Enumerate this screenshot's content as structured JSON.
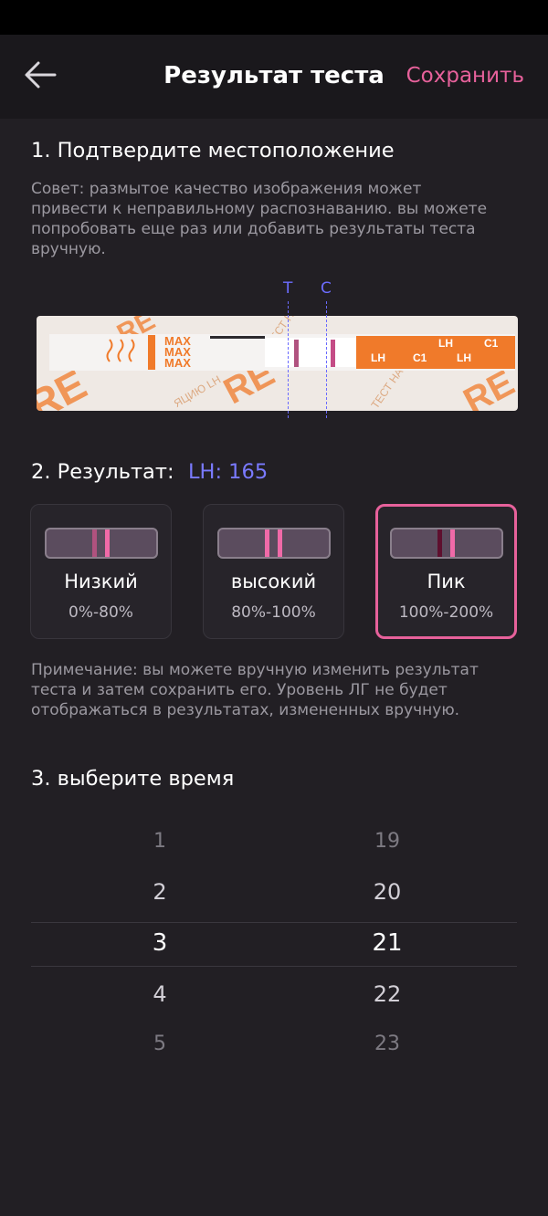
{
  "header": {
    "title": "Результат теста",
    "save_label": "Сохранить"
  },
  "step1": {
    "title": "1. Подтвердите местоположение",
    "hint_lines": [
      "Совет: размытое качество изображения может",
      "привести к неправильному распознаванию. вы можете",
      "попробовать еще раз или добавить результаты теста",
      "вручную."
    ],
    "marker_t": "T",
    "marker_c": "C",
    "strip_text": {
      "max": "MAX",
      "lh": "LH",
      "c1": "C1",
      "brand": "RE",
      "test_ha": "ТЕСТ НА",
      "ovulation": "ЯЦИЮ LH"
    }
  },
  "step2": {
    "title": "2. Результат:",
    "value": "LH: 165",
    "options": [
      {
        "name": "Низкий",
        "range": "0%-80%"
      },
      {
        "name": "высокий",
        "range": "80%-100%"
      },
      {
        "name": "Пик",
        "range": "100%-200%"
      }
    ],
    "selected_option": "Пик",
    "note_lines": [
      "Примечание: вы можете вручную изменить результат",
      "теста и затем сохранить его. Уровень ЛГ не будет",
      "отображаться в результатах, измененных вручную."
    ]
  },
  "step3": {
    "title": "3. выберите время",
    "hours": [
      "1",
      "2",
      "3",
      "4",
      "5"
    ],
    "minutes": [
      "19",
      "20",
      "21",
      "22",
      "23"
    ],
    "selected_hour": "3",
    "selected_minute": "21"
  },
  "colors": {
    "background": "#221f24",
    "accent_pink": "#e7619b",
    "accent_blue": "#7a7aff",
    "strip_orange": "#f07a2a"
  },
  "icons": {
    "back": "arrow-left-icon"
  }
}
